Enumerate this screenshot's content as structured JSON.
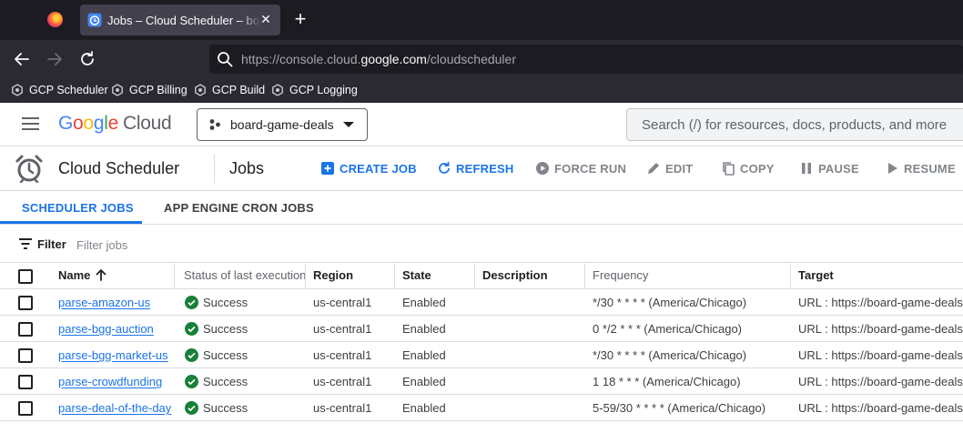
{
  "browser": {
    "tab_title": "Jobs – Cloud Scheduler – board-game-deals – Google Cloud console",
    "url_prefix": "https://console.cloud.",
    "url_host": "google.com",
    "url_path": "/cloudscheduler",
    "bookmarks": [
      "GCP Scheduler",
      "GCP Billing",
      "GCP Build",
      "GCP Logging"
    ]
  },
  "header": {
    "logo_google": [
      "G",
      "o",
      "o",
      "g",
      "l",
      "e"
    ],
    "logo_cloud": "Cloud",
    "project": "board-game-deals",
    "search_placeholder": "Search (/) for resources, docs, products, and more"
  },
  "page": {
    "product": "Cloud Scheduler",
    "title": "Jobs",
    "actions": {
      "create": "CREATE JOB",
      "refresh": "REFRESH",
      "force_run": "FORCE RUN",
      "edit": "EDIT",
      "copy": "COPY",
      "pause": "PAUSE",
      "resume": "RESUME"
    },
    "tabs": [
      "SCHEDULER JOBS",
      "APP ENGINE CRON JOBS"
    ],
    "filter_label": "Filter",
    "filter_placeholder": "Filter jobs"
  },
  "table": {
    "columns": {
      "name": "Name",
      "status": "Status of last execution",
      "region": "Region",
      "state": "State",
      "description": "Description",
      "frequency": "Frequency",
      "target": "Target"
    },
    "rows": [
      {
        "name": "parse-amazon-us",
        "status": "Success",
        "region": "us-central1",
        "state": "Enabled",
        "description": "",
        "frequency": "*/30 * * * * (America/Chicago)",
        "target": "URL : https://board-game-deals-"
      },
      {
        "name": "parse-bgg-auction",
        "status": "Success",
        "region": "us-central1",
        "state": "Enabled",
        "description": "",
        "frequency": "0 */2 * * * (America/Chicago)",
        "target": "URL : https://board-game-deals-"
      },
      {
        "name": "parse-bgg-market-us",
        "status": "Success",
        "region": "us-central1",
        "state": "Enabled",
        "description": "",
        "frequency": "*/30 * * * * (America/Chicago)",
        "target": "URL : https://board-game-deals-"
      },
      {
        "name": "parse-crowdfunding",
        "status": "Success",
        "region": "us-central1",
        "state": "Enabled",
        "description": "",
        "frequency": "1 18 * * * (America/Chicago)",
        "target": "URL : https://board-game-deals-"
      },
      {
        "name": "parse-deal-of-the-day",
        "status": "Success",
        "region": "us-central1",
        "state": "Enabled",
        "description": "",
        "frequency": "5-59/30 * * * * (America/Chicago)",
        "target": "URL : https://board-game-deals-"
      }
    ]
  },
  "colors": {
    "primary": "#1a73e8",
    "success": "#188038"
  }
}
